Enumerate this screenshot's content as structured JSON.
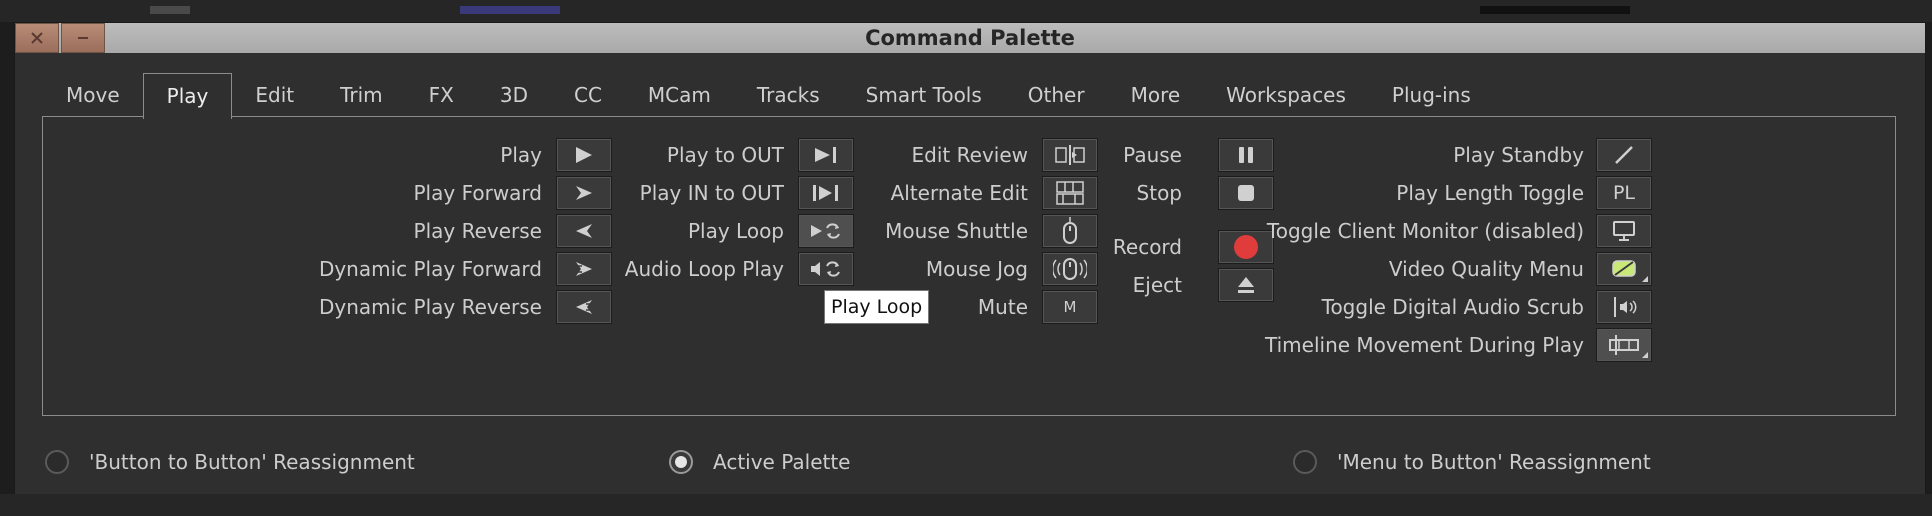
{
  "window": {
    "title": "Command Palette",
    "close_icon": "close-x-icon",
    "minimize_icon": "minimize-icon"
  },
  "tabs": [
    {
      "label": "Move"
    },
    {
      "label": "Play"
    },
    {
      "label": "Edit"
    },
    {
      "label": "Trim"
    },
    {
      "label": "FX"
    },
    {
      "label": "3D"
    },
    {
      "label": "CC"
    },
    {
      "label": "MCam"
    },
    {
      "label": "Tracks"
    },
    {
      "label": "Smart Tools"
    },
    {
      "label": "Other"
    },
    {
      "label": "More"
    },
    {
      "label": "Workspaces"
    },
    {
      "label": "Plug-ins"
    }
  ],
  "active_tab": "Play",
  "commands": {
    "col1": [
      {
        "label": "Play",
        "icon": "play-icon"
      },
      {
        "label": "Play Forward",
        "icon": "play-forward-icon"
      },
      {
        "label": "Play Reverse",
        "icon": "play-reverse-icon"
      },
      {
        "label": "Dynamic Play Forward",
        "icon": "dynamic-play-forward-icon"
      },
      {
        "label": "Dynamic Play Reverse",
        "icon": "dynamic-play-reverse-icon"
      }
    ],
    "col2": [
      {
        "label": "Play to OUT",
        "icon": "play-to-out-icon"
      },
      {
        "label": "Play IN to OUT",
        "icon": "play-in-to-out-icon"
      },
      {
        "label": "Play Loop",
        "icon": "play-loop-icon"
      },
      {
        "label": "Audio Loop Play",
        "icon": "audio-loop-play-icon"
      }
    ],
    "col3": [
      {
        "label": "Edit Review",
        "icon": "edit-review-icon"
      },
      {
        "label": "Alternate Edit",
        "icon": "alternate-edit-icon"
      },
      {
        "label": "Mouse Shuttle",
        "icon": "mouse-shuttle-icon"
      },
      {
        "label": "Mouse Jog",
        "icon": "mouse-jog-icon"
      },
      {
        "label": "Mute",
        "icon": "mute-icon",
        "text": "M"
      }
    ],
    "col4": [
      {
        "label": "Pause",
        "icon": "pause-icon"
      },
      {
        "label": "Stop",
        "icon": "stop-icon"
      },
      {
        "label": "Record",
        "icon": "record-icon"
      },
      {
        "label": "Eject",
        "icon": "eject-icon"
      }
    ],
    "col5": [
      {
        "label": "Play Standby",
        "icon": "play-standby-icon"
      },
      {
        "label": "Play Length Toggle",
        "icon": "play-length-toggle-icon",
        "text": "PL"
      },
      {
        "label": "Toggle Client Monitor (disabled)",
        "icon": "client-monitor-icon"
      },
      {
        "label": "Video Quality Menu",
        "icon": "video-quality-icon"
      },
      {
        "label": "Toggle Digital Audio Scrub",
        "icon": "digital-audio-scrub-icon"
      },
      {
        "label": "Timeline Movement During Play",
        "icon": "timeline-movement-icon"
      }
    ]
  },
  "tooltip": {
    "text": "Play Loop"
  },
  "radio_options": [
    {
      "label": "'Button to Button' Reassignment",
      "selected": false
    },
    {
      "label": "Active Palette",
      "selected": true
    },
    {
      "label": "'Menu to Button' Reassignment",
      "selected": false
    }
  ],
  "colors": {
    "record": "#e03c3c",
    "video_quality_fill": "#c8e878"
  }
}
